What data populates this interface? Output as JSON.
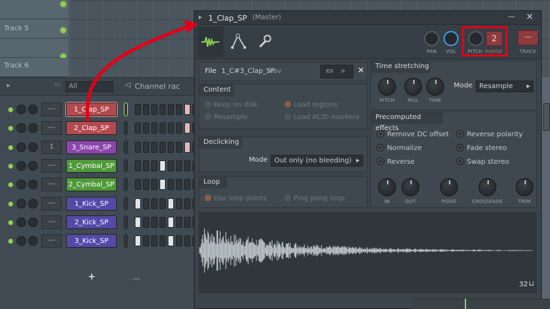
{
  "playlist": {
    "tracks": [
      {
        "label": "Track 5"
      },
      {
        "label": "Track 6"
      }
    ]
  },
  "channel_rack": {
    "filter": "All",
    "title": "Channel rac",
    "add_label": "+",
    "channels": [
      {
        "num": "---",
        "name": "1_Clap_SP",
        "color": "#b24a4f"
      },
      {
        "num": "---",
        "name": "2_Clap_SP",
        "color": "#b24a4f"
      },
      {
        "num": "1",
        "name": "3_Snare_SP",
        "color": "#8c45ad"
      },
      {
        "num": "---",
        "name": "1_Cymbal_SP",
        "color": "#4f9a3a"
      },
      {
        "num": "---",
        "name": "2_Cymbal_SP",
        "color": "#4f9a3a"
      },
      {
        "num": "---",
        "name": "1_Kick_SP",
        "color": "#5549a8"
      },
      {
        "num": "---",
        "name": "2_Kick_SP",
        "color": "#5549a8"
      },
      {
        "num": "---",
        "name": "3_Kick_SP",
        "color": "#5549a8"
      }
    ]
  },
  "sampler": {
    "title": "1_Clap_SP",
    "subtitle": "(Master)",
    "close": "×",
    "controls": {
      "pan": "PAN",
      "vol": "VOL",
      "pitch": "PITCH",
      "range": "RANGE",
      "range_value": "2",
      "track": "TRACK",
      "track_value": "---"
    },
    "file": {
      "label": "File",
      "name": "1_C#3_Clap_SP",
      "ext": "wav"
    },
    "content": {
      "header": "Content",
      "keep_on_disk": "Keep on disk",
      "load_regions": "Load regions",
      "resample": "Resample",
      "load_acid": "Load ACID markers"
    },
    "declicking": {
      "header": "Declicking",
      "mode_label": "Mode",
      "mode_value": "Out only (no bleeding)"
    },
    "loop": {
      "header": "Loop",
      "use_loop_points": "Use loop points",
      "ping_pong": "Ping pong loop"
    },
    "time_stretching": {
      "header": "Time stretching",
      "pitch": "PITCH",
      "mul": "MUL",
      "time": "TIME",
      "mode_label": "Mode",
      "mode_value": "Resample"
    },
    "precomputed": {
      "header": "Precomputed effects",
      "remove_dc": "Remove DC offset",
      "reverse_polarity": "Reverse polarity",
      "normalize": "Normalize",
      "fade_stereo": "Fade stereo",
      "reverse": "Reverse",
      "swap_stereo": "Swap stereo",
      "in": "IN",
      "out": "OUT",
      "pogo": "POGO",
      "crossfade": "CROSSFADE",
      "trim": "TRIM"
    },
    "waveform": {
      "zoom": "32"
    }
  },
  "colors": {
    "highlight": "#e0001a",
    "accent_knob": "#3aa0e0"
  }
}
